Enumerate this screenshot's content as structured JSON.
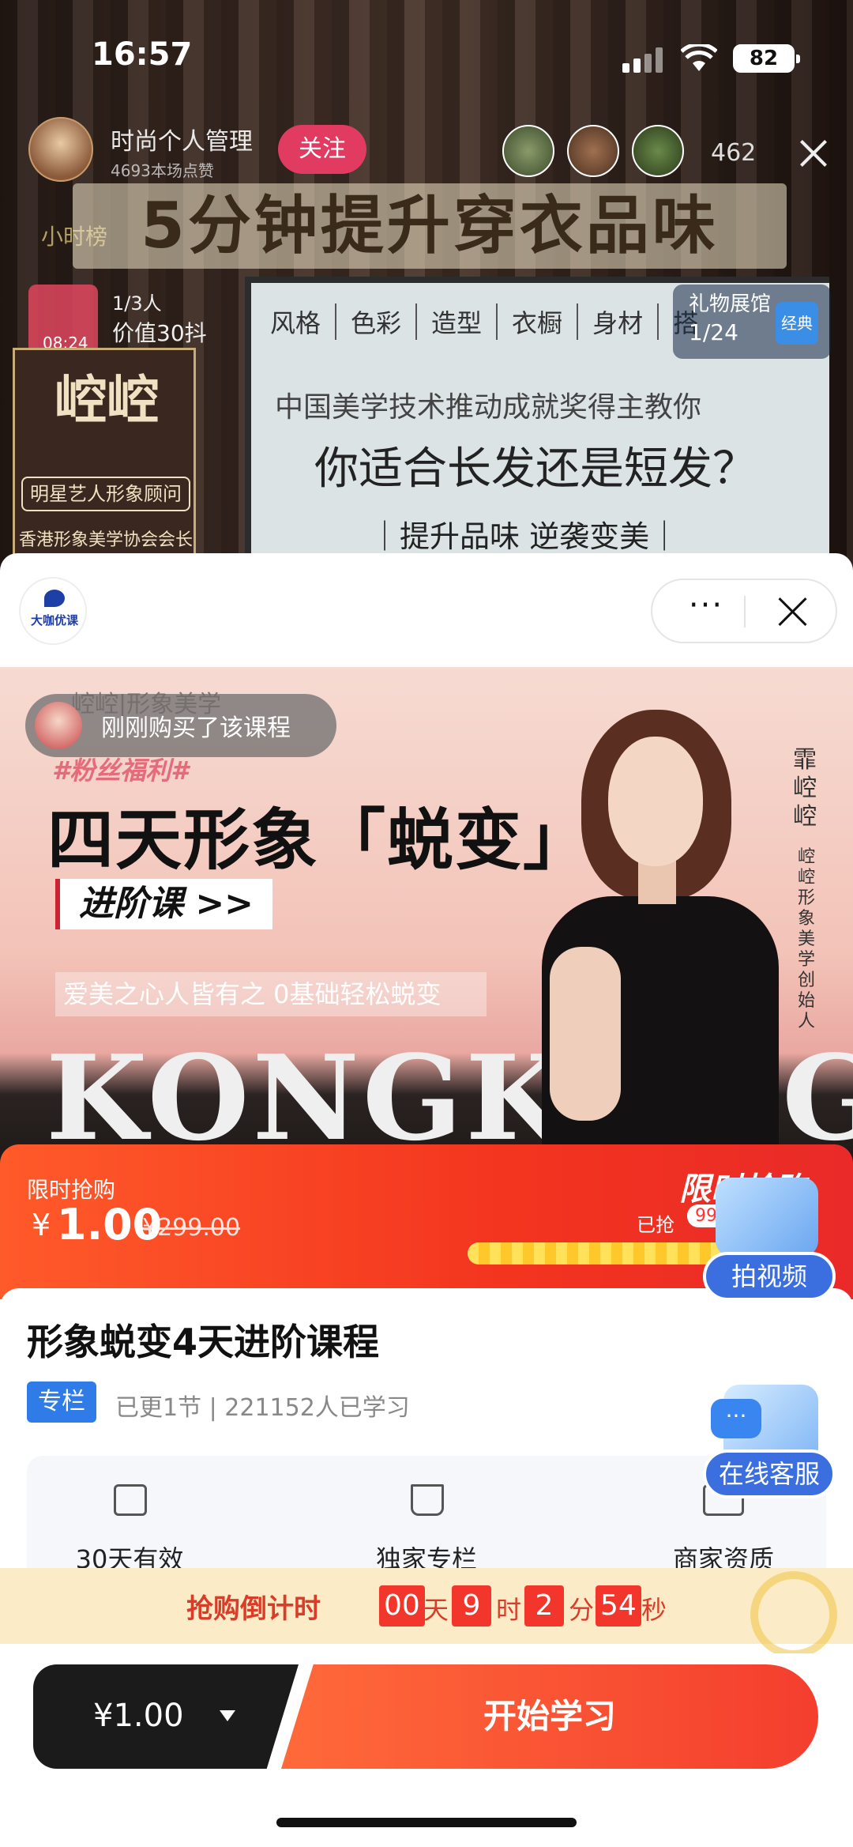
{
  "status_bar": {
    "time": "16:57",
    "battery": "82"
  },
  "live": {
    "host_name": "时尚个人管理",
    "host_likes": "4693本场点赞",
    "follow_label": "关注",
    "viewer_count": "462",
    "hour_rank": "小时榜",
    "headline": "5分钟提升穿衣品味",
    "rank_line1": "1/3人",
    "rank_line2": "价值30抖",
    "rank_time": "08:24",
    "stage_name": "崆崆",
    "stage_line1": "明星艺人形象顾问",
    "stage_line2": "香港形象美学协会会长",
    "board_menu": [
      "风格",
      "色彩",
      "造型",
      "衣橱",
      "身材",
      "搭"
    ],
    "board_line1": "中国美学技术推动成就奖得主教你",
    "board_line2": "你适合长发还是短发？",
    "board_line3": "｜提升品味  逆袭变美｜",
    "gifts_title": "礼物展馆",
    "gifts_count": "1/24",
    "gifts_badge": "经典"
  },
  "sheet": {
    "logo_text": "大咖优课",
    "more_label": "···",
    "banner": {
      "brand": "崆崆|形象美学",
      "toast": "刚刚购买了该课程",
      "tag": "#粉丝福利#",
      "main_title": "四天形象「蜕变」",
      "sub_title": "进阶课 >>",
      "slogan": "爱美之心人皆有之 0基础轻松蜕变",
      "big_english": "KONGKONG",
      "name_vertical": "霏崆崆",
      "role_vertical": "崆崆形象美学创始人"
    },
    "flash": {
      "label": "限时抢购",
      "currency": "¥",
      "price": "1.00",
      "original_price": "¥299.00",
      "big_label": "限时抢购",
      "sold_label": "已抢",
      "sold_percent": "99%",
      "progress": 0.99
    },
    "course": {
      "title": "形象蜕变4天进阶课程",
      "tag": "专栏",
      "meta": "已更1节 | 221152人已学习"
    },
    "features": [
      {
        "icon": "calendar-clock-icon",
        "label": "30天有效"
      },
      {
        "icon": "bookmark-icon",
        "label": "独家专栏"
      },
      {
        "icon": "id-card-icon",
        "label": "商家资质"
      }
    ],
    "countdown": {
      "label": "抢购倒计时",
      "days": "00",
      "day_unit": "天",
      "hours": "9",
      "hour_unit": "时",
      "minutes": "2",
      "minute_unit": "分",
      "seconds": "54",
      "second_unit": "秒"
    },
    "float_video": "拍视频",
    "float_service": "在线客服",
    "bottom": {
      "price_label": "¥1.00",
      "start_label": "开始学习"
    }
  }
}
